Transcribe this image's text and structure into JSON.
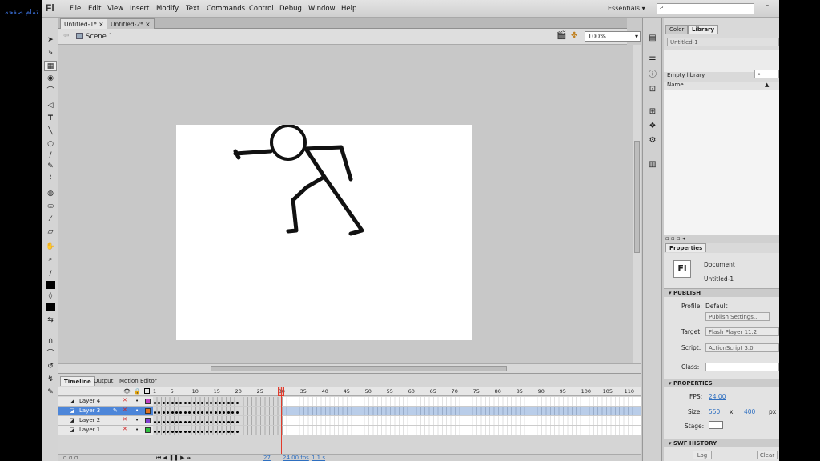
{
  "overlay": {
    "text": "تمام صفحه"
  },
  "app": {
    "logo": "Fl"
  },
  "menu": [
    "File",
    "Edit",
    "View",
    "Insert",
    "Modify",
    "Text",
    "Commands",
    "Control",
    "Debug",
    "Window",
    "Help"
  ],
  "workspace": {
    "label": "Essentials",
    "arrow": "▾"
  },
  "search": {
    "icon": "⌕",
    "placeholder": ""
  },
  "window_controls": {
    "minimize": "–",
    "restore": "❐",
    "close": "✕"
  },
  "doc_tabs": [
    {
      "label": "Untitled-1*",
      "close": "×"
    },
    {
      "label": "Untitled-2*",
      "close": "×"
    }
  ],
  "edit_bar": {
    "scene": "Scene 1",
    "zoom": "100%"
  },
  "tools": [
    "➤",
    "⤷",
    "▦",
    "◉",
    "⌒",
    "◁",
    "T",
    "╲",
    "○",
    "∕",
    "✎",
    "⌇",
    "◍",
    "⛀",
    "⁄",
    "▱",
    "✋",
    "⌕",
    "∕",
    "■",
    "◊",
    "■",
    "⇆",
    "∩",
    "⌒",
    "↺",
    "↯",
    "✎"
  ],
  "right_panel": {
    "tabs": [
      "Color",
      "Library"
    ],
    "library": {
      "doc": "Untitled-1",
      "empty_label": "Empty library",
      "name_col": "Name",
      "sort_icon": "▲"
    },
    "properties": {
      "tab": "Properties",
      "doc_type": "Document",
      "doc_name": "Untitled-1",
      "fl_badge": "Fl",
      "publish_section": "PUBLISH",
      "profile_label": "Profile:",
      "profile_value": "Default",
      "publish_settings": "Publish Settings...",
      "target_label": "Target:",
      "target_value": "Flash Player 11.2",
      "script_label": "Script:",
      "script_value": "ActionScript 3.0",
      "class_label": "Class:",
      "properties_section": "PROPERTIES",
      "fps_label": "FPS:",
      "fps_value": "24.00",
      "size_label": "Size:",
      "width": "550",
      "x": "x",
      "height": "400",
      "px": "px",
      "stage_label": "Stage:",
      "swf_section": "SWF HISTORY",
      "log_btn": "Log",
      "clear_btn": "Clear"
    }
  },
  "timeline": {
    "tabs": [
      "Timeline",
      "Output",
      "Motion Editor"
    ],
    "ruler": [
      "1",
      "5",
      "10",
      "15",
      "20",
      "25",
      "30",
      "35",
      "40",
      "45",
      "50",
      "55",
      "60",
      "65",
      "70",
      "75",
      "80",
      "85",
      "90",
      "95",
      "100",
      "105",
      "110"
    ],
    "layers": [
      {
        "name": "Layer 4",
        "color": "#c040c0",
        "selected": false
      },
      {
        "name": "Layer 3",
        "color": "#e07020",
        "selected": true
      },
      {
        "name": "Layer 2",
        "color": "#8040d0",
        "selected": false
      },
      {
        "name": "Layer 1",
        "color": "#30c040",
        "selected": false
      }
    ],
    "status": {
      "frame": "27",
      "fps": "24.00 fps",
      "time": "1.1 s"
    },
    "controls": "⏮ ◀ ❚❚ ▶ ⏭"
  }
}
